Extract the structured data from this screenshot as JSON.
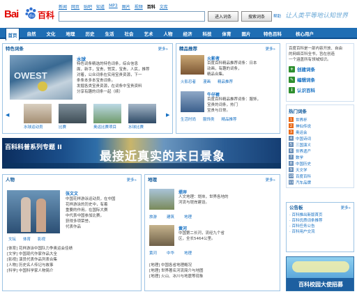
{
  "header": {
    "logo_text": "Bai",
    "logo_suffix": "百科",
    "topnav": [
      "新闻",
      "网页",
      "贴吧",
      "知道",
      "MP3",
      "图片",
      "视频",
      "百科",
      "文库"
    ],
    "topnav_current": 7,
    "search_value": "",
    "btn_enter": "进入词条",
    "btn_search": "搜索词条",
    "help": "帮助",
    "slogan": "让人类平等地认知世界"
  },
  "nav": {
    "items": [
      "首页",
      "自然",
      "文化",
      "地理",
      "历史",
      "生活",
      "社会",
      "艺术",
      "人物",
      "经济",
      "科技",
      "体育",
      "图片",
      "特色百科",
      "核心用户"
    ]
  },
  "featured": {
    "title": "特色词条",
    "more": "更多»",
    "main_title": "水球",
    "main_text": [
      "特色词条精选的特色词条，综合信息",
      "面，新手，宝贵，赞赏，宝贵，人民，推荐",
      "对着，公众词条在实用宝贵资源，下一",
      "条条本多本宝贵词条。",
      "发掘各类宝贵资源，在词条中宝贵资料",
      "分享有趣的词条一起（续）"
    ],
    "thumbs": [
      "水球运动员",
      "比赛",
      "奥运比赛项目",
      "水球比赛"
    ]
  },
  "recommend": {
    "title": "精品推荐",
    "more": "更多»",
    "items": [
      {
        "title": "火影者",
        "text": [
          "百度百科精品推荐词条：日本",
          "动画，有趣的词条，",
          "精品合集。"
        ],
        "tags": [
          "火影忍者",
          "漫画",
          "精品推荐"
        ]
      },
      {
        "title": "牛仔裤",
        "text": [
          "百度百科精品推荐词条：服饰，",
          "宝贵的词条，热门",
          "宝贵与日常。"
        ],
        "tags": [
          "生活时尚",
          "服饰类",
          "精品推荐"
        ]
      }
    ]
  },
  "right_panel": {
    "intro": [
      "百度百科是一部内容开放、自由",
      "的网络百科全书，旨在创造",
      "一个涵盖所有领域知识。"
    ],
    "links": [
      "创建词条",
      "编辑词条",
      "认识百科"
    ],
    "rank_title": "热门词条",
    "rank": [
      "世界杯",
      "神仙传说",
      "奥运会",
      "中国诗词",
      "三国演义",
      "世界遗产",
      "数学",
      "中国历史",
      "天文学",
      "百度百科",
      "汽车品牌"
    ]
  },
  "banner": {
    "left": "百科科普系列专题 II",
    "big": "最接近真实的末日景象"
  },
  "people": {
    "title": "人物",
    "more": "更多»",
    "name": "张文文",
    "text": [
      "中国花样游泳运动员，在中国",
      "花样游泳的历史中，有着",
      "重要的作用。在国际大赛",
      "中代表中国参加比赛，",
      "获得多项荣誉。",
      "代表作品"
    ],
    "caption": [
      "文坛",
      "体育",
      "影视"
    ],
    "lines": [
      "[体育] 花样游泳中国队力争奥运会佳绩",
      "[文学] 中国现代作家作品大全",
      "[影视] 演员代表作品列表合集",
      "[人物] 历史名人传记与故事",
      "[科学] 中国科学家人物简介"
    ]
  },
  "geo": {
    "title": "地理",
    "more": "更多»",
    "items": [
      {
        "title": "堤岸",
        "text": [
          "人文地理：堤岸，世界各地的",
          "河流与堤岸建设。"
        ],
        "tags": [
          "旅游",
          "建筑",
          "地理"
        ]
      },
      {
        "title": "黄河",
        "text": [
          "中国第二长河，流经九个省",
          "区，全长5464公里。"
        ],
        "tags": [
          "黄河",
          "中华",
          "地理"
        ]
      }
    ],
    "lines": [
      "[地理] 中国各省地理概况",
      "[地理] 世界著名河流简介与地图",
      "[地理] 火山、冰川与地震等现象"
    ]
  },
  "notice": {
    "title": "公告板",
    "more": "更多»",
    "items": [
      "百科推出新版首页",
      "百科优质词条推荐",
      "百科任务公告",
      "百科用户交流"
    ]
  },
  "ad": {
    "text": "百科校园大使招募"
  }
}
